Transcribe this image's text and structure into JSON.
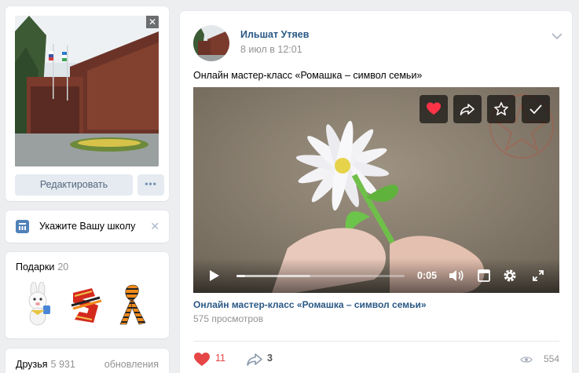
{
  "profile": {
    "edit_label": "Редактировать",
    "more_label": "•••",
    "close_glyph": "✕"
  },
  "school": {
    "label": "Укажите Вашу школу",
    "close_glyph": "✕"
  },
  "gifts": {
    "title": "Подарки",
    "count": "20",
    "items": [
      "bunny-gift",
      "victory-ribbon-gift",
      "st-george-ribbon-gift"
    ]
  },
  "friends": {
    "title": "Друзья",
    "count": "5 931",
    "updates_label": "обновления"
  },
  "post": {
    "author": "Ильшат Утяев",
    "date": "8 июл в 12:01",
    "text": "Онлайн мастер-класс «Ромашка – символ семьи»",
    "video": {
      "time": "0:05",
      "progress": 0.05,
      "buffered": 0.44,
      "title": "Онлайн мастер-класс «Ромашка – символ семьи»",
      "views": "575 просмотров",
      "overlay_buttons": [
        "heart-icon",
        "share-icon",
        "star-icon",
        "check-icon"
      ],
      "controls": [
        "play-icon",
        "volume-icon",
        "miniplayer-icon",
        "settings-icon",
        "fullscreen-icon"
      ]
    },
    "likes": "11",
    "shares": "3",
    "views": "554"
  },
  "colors": {
    "accent": "#2a5885",
    "like": "#e64646",
    "button_bg": "#e5ebf1"
  }
}
